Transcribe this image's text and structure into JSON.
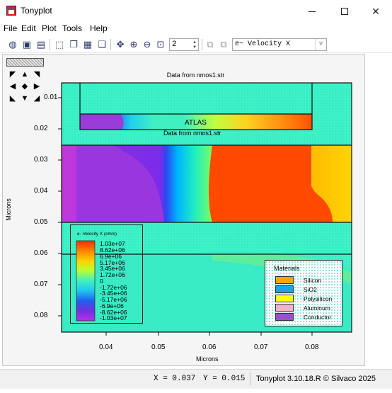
{
  "window": {
    "title": "Tonyplot"
  },
  "menu": [
    "File",
    "Edit",
    "Plot",
    "Tools",
    "Help"
  ],
  "toolbar": {
    "zoom_value": "2",
    "quantity_value": "e− Velocity X"
  },
  "plot": {
    "title": "ATLAS",
    "subtitle": "Data from nmos1.str",
    "xlabel": "Microns",
    "ylabel": "Microns",
    "x_ticks": [
      "0.04",
      "0.05",
      "0.06",
      "0.07",
      "0.08"
    ],
    "y_ticks": [
      "0.01",
      "0.02",
      "0.03",
      "0.04",
      "0.05",
      "0.06",
      "0.07",
      "0.08"
    ]
  },
  "legend": {
    "title": "e- Velocity X (cm/s)",
    "labels": [
      "1.03e+07",
      "8.62e+06",
      "6.9e+06",
      "5.17e+06",
      "3.45e+06",
      "1.72e+06",
      "0",
      "-1.72e+06",
      "-3.45e+06",
      "-5.17e+06",
      "-6.9e+06",
      "-8.62e+06",
      "-1.03e+07"
    ]
  },
  "materials": {
    "title": "Materials",
    "items": [
      {
        "name": "Silicon",
        "color": "#f5a800"
      },
      {
        "name": "SiO2",
        "color": "#1fa3e6"
      },
      {
        "name": "Polysilicon",
        "color": "#ffff00"
      },
      {
        "name": "Aluminum",
        "color": "#f0b4c8"
      },
      {
        "name": "Conductor",
        "color": "#9a4fd4"
      }
    ]
  },
  "status": {
    "x_readout": "X = 0.037",
    "y_readout": "Y = 0.015",
    "version": "Tonyplot 3.10.18.R © Silvaco 2025"
  }
}
